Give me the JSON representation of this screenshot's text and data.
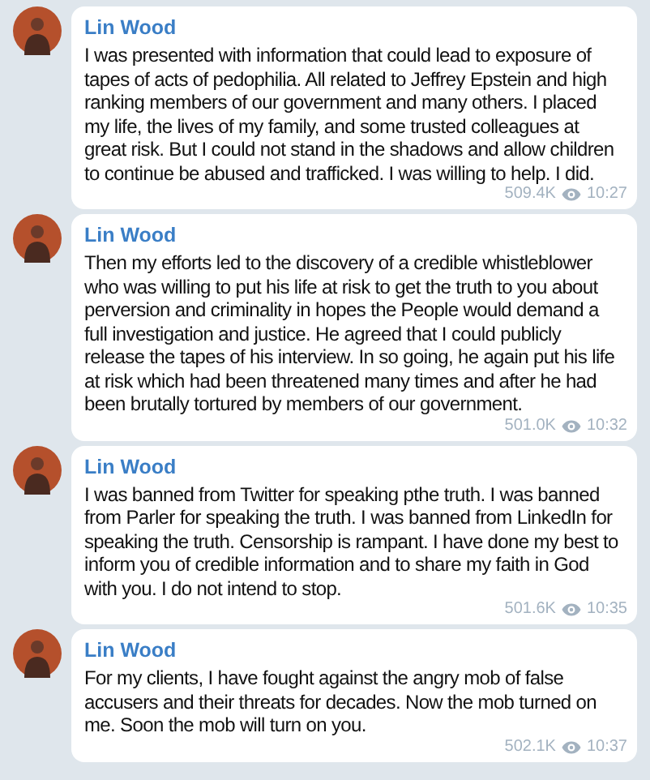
{
  "messages": [
    {
      "author": "Lin Wood",
      "text": "I was presented with information that could lead to exposure of tapes of acts of pedophilia. All related to Jeffrey Epstein and high ranking members of our government and many others. I placed my life, the lives of my family, and some trusted colleagues at great risk. But I could not stand in the shadows and allow children to continue be abused and trafficked. I was willing to help. I did.",
      "views": "509.4K",
      "time": "10:27"
    },
    {
      "author": "Lin Wood",
      "text": "Then my efforts led to the discovery of a credible whistleblower who was willing to put his life at risk to get the truth to you about perversion and criminality in hopes the People would demand a full investigation and justice. He agreed that I could publicly release the tapes of his interview. In so going, he again put his life at risk which had been threatened many times and after he had been brutally tortured by members of our government.",
      "views": "501.0K",
      "time": "10:32"
    },
    {
      "author": "Lin Wood",
      "text": "I was banned from Twitter for speaking pthe truth. I was banned from Parler for speaking the truth. I was banned from LinkedIn for speaking the truth. Censorship is rampant. I have done my best to inform you of credible information and to share my faith in God with you. I do not intend to stop.",
      "views": "501.6K",
      "time": "10:35"
    },
    {
      "author": "Lin Wood",
      "text": "For my clients, I have fought against the angry mob of false accusers and their threats for decades. Now the mob turned on me. Soon the mob will turn on you.",
      "views": "502.1K",
      "time": "10:37"
    }
  ]
}
